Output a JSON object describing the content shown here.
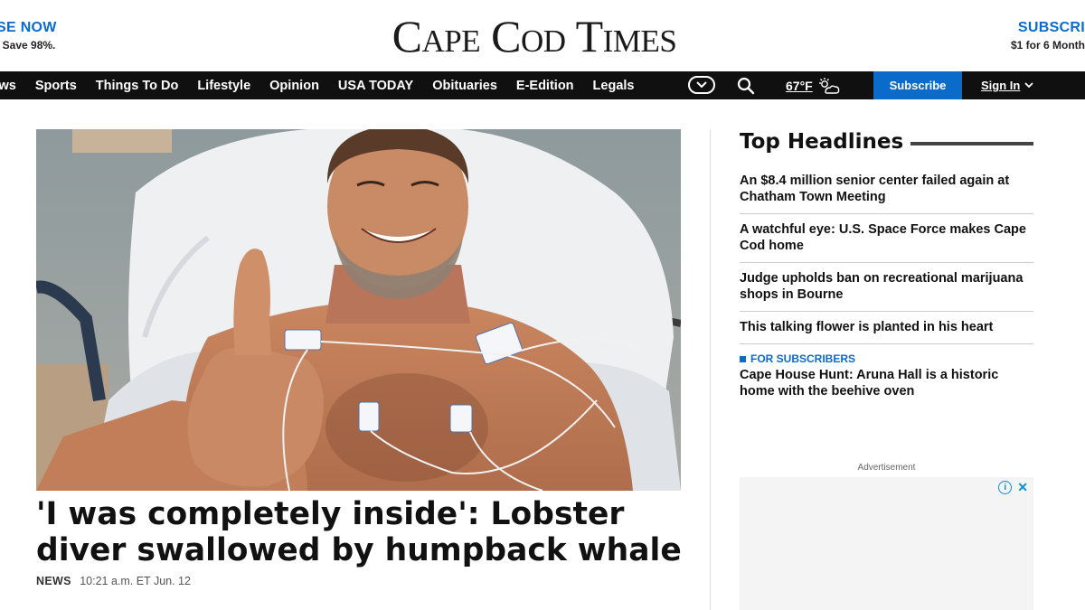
{
  "masthead": {
    "logo": "Cape Cod Times",
    "promo_left": {
      "cta": "SE NOW",
      "sub": ". Save 98%."
    },
    "promo_right": {
      "cta": "SUBSCRI",
      "sub": "$1 for 6 Month"
    }
  },
  "nav": {
    "items": [
      "ws",
      "Sports",
      "Things To Do",
      "Lifestyle",
      "Opinion",
      "USA TODAY",
      "Obituaries",
      "E-Edition",
      "Legals"
    ],
    "weather_temp": "67°F",
    "subscribe": "Subscribe",
    "signin": "Sign In"
  },
  "lead": {
    "headline": "'I was completely inside': Lobster diver swallowed by humpback whale",
    "section": "NEWS",
    "timestamp": "10:21 a.m. ET Jun. 12"
  },
  "rail": {
    "title": "Top Headlines",
    "headlines": [
      "An $8.4 million senior center failed again at Chatham Town Meeting",
      "A watchful eye: U.S. Space Force makes Cape Cod home",
      "Judge upholds ban on recreational marijuana shops in Bourne",
      "This talking flower is planted in his heart"
    ],
    "subscriber_item": {
      "tag": "FOR SUBSCRIBERS",
      "title": "Cape House Hunt: Aruna Hall is a historic home with the beehive oven"
    },
    "ad_label": "Advertisement"
  },
  "colors": {
    "brand_blue": "#0b6bcb",
    "nav_bg": "#101010"
  }
}
